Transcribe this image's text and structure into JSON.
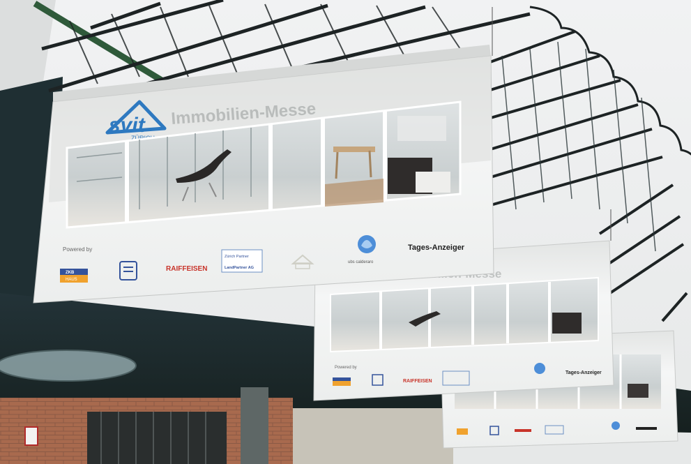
{
  "banner": {
    "logo_text": "svit",
    "logo_sub": "ZÜRICH",
    "title": "Immobilien-Messe",
    "powered_by": "Powered by",
    "sponsors": {
      "raiffeisen": "RAIFFEISEN",
      "zkb_box": "ZKB",
      "zkb_sub": "HAUS",
      "landpartner_line1": "Zürich Partner",
      "landpartner_line2": "LandPartner AG",
      "ubs": "ubs calderaro",
      "tages": "Tages-Anzeiger"
    }
  },
  "colors": {
    "sky": "#eeeff0",
    "canopy_dark": "#1e2a2c",
    "canopy_frame": "#2f5a3a",
    "banner_bg": "#f3f4f4",
    "banner_band": "#d9dbd9",
    "logo_blue": "#2e79c0",
    "title_grey": "#b9bcbb",
    "raiffeisen_red": "#c8342a",
    "brick": "#a86a4e"
  }
}
